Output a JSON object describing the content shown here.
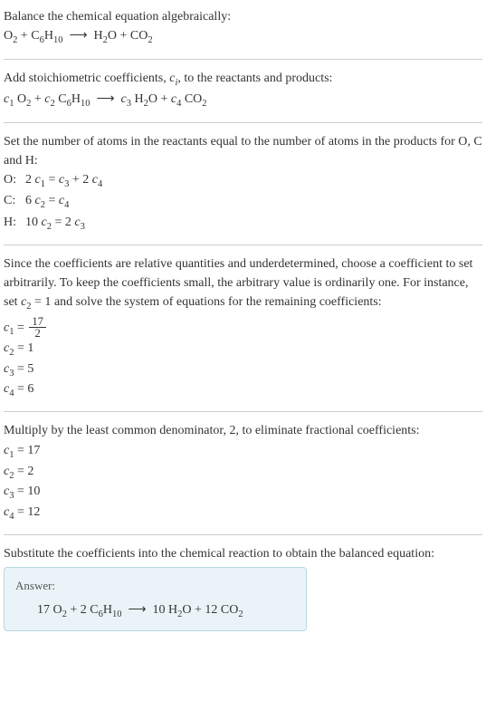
{
  "section1": {
    "title": "Balance the chemical equation algebraically:",
    "equation": "O₂ + C₆H₁₀ ⟶ H₂O + CO₂"
  },
  "section2": {
    "text_before": "Add stoichiometric coefficients, ",
    "ci": "cᵢ",
    "text_after": ", to the reactants and products:",
    "equation_parts": {
      "c1": "c₁",
      "r1": " O₂ + ",
      "c2": "c₂",
      "r2": " C₆H₁₀ ⟶ ",
      "c3": "c₃",
      "r3": " H₂O + ",
      "c4": "c₄",
      "r4": " CO₂"
    }
  },
  "section3": {
    "title": "Set the number of atoms in the reactants equal to the number of atoms in the products for O, C and H:",
    "rows": [
      {
        "label": "O:",
        "eq": "2 c₁ = c₃ + 2 c₄"
      },
      {
        "label": "C:",
        "eq": "6 c₂ = c₄"
      },
      {
        "label": "H:",
        "eq": "10 c₂ = 2 c₃"
      }
    ]
  },
  "section4": {
    "text_before": "Since the coefficients are relative quantities and underdetermined, choose a coefficient to set arbitrarily. To keep the coefficients small, the arbitrary value is ordinarily one. For instance, set ",
    "c2eq": "c₂ = 1",
    "text_after": " and solve the system of equations for the remaining coefficients:",
    "c1_lhs": "c₁ = ",
    "c1_num": "17",
    "c1_den": "2",
    "coeffs": [
      "c₂ = 1",
      "c₃ = 5",
      "c₄ = 6"
    ]
  },
  "section5": {
    "title": "Multiply by the least common denominator, 2, to eliminate fractional coefficients:",
    "coeffs": [
      "c₁ = 17",
      "c₂ = 2",
      "c₃ = 10",
      "c₄ = 12"
    ]
  },
  "section6": {
    "title": "Substitute the coefficients into the chemical reaction to obtain the balanced equation:",
    "answer_label": "Answer:",
    "answer": "17 O₂ + 2 C₆H₁₀ ⟶ 10 H₂O + 12 CO₂"
  }
}
